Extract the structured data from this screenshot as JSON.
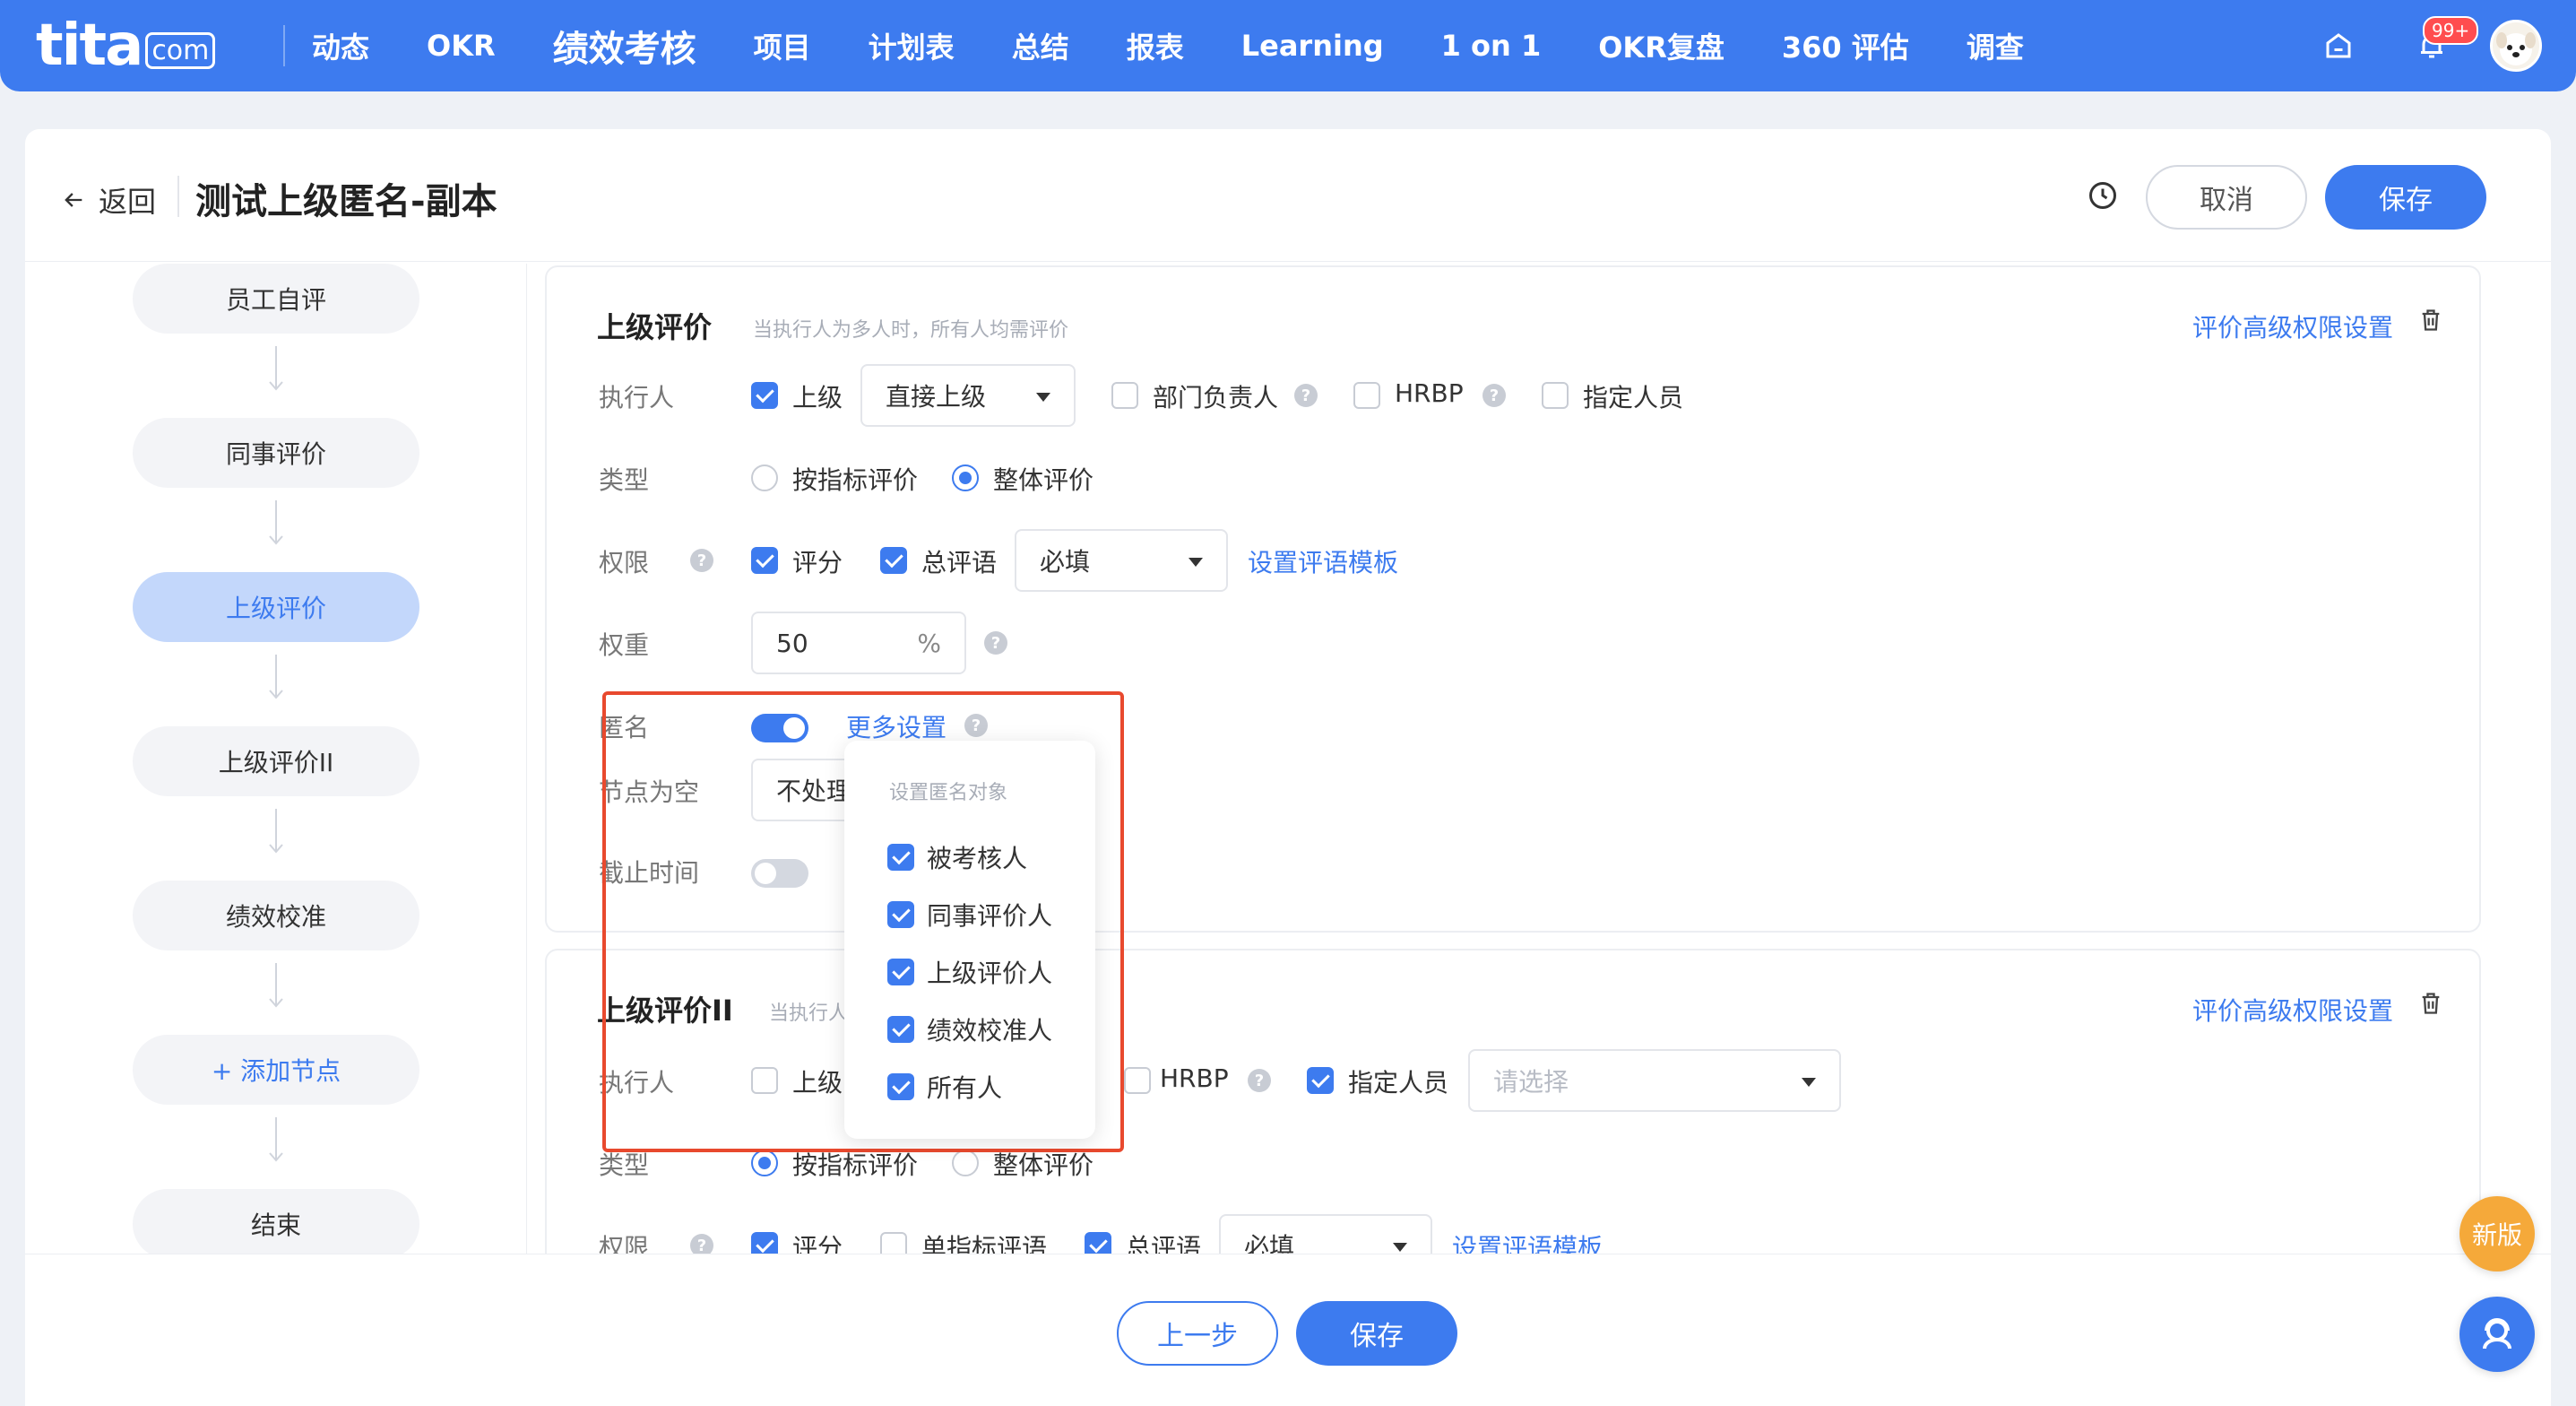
{
  "app": {
    "logo": "tita",
    "logo_suffix": "com",
    "notification_badge": "99+",
    "colors": {
      "primary": "#3d7bef",
      "highlight": "#e8492e",
      "new_badge": "#f5a93a"
    }
  },
  "nav": {
    "items": [
      "动态",
      "OKR",
      "绩效考核",
      "项目",
      "计划表",
      "总结",
      "报表",
      "Learning",
      "1 on 1",
      "OKR复盘",
      "360 评估",
      "调查"
    ],
    "active_index": 2
  },
  "header": {
    "back_label": "返回",
    "title": "测试上级匿名-副本",
    "cancel_label": "取消",
    "save_label": "保存"
  },
  "flow": {
    "nodes": [
      "员工自评",
      "同事评价",
      "上级评价",
      "上级评价II",
      "绩效校准",
      "+ 添加节点",
      "结束"
    ],
    "active_index": 2
  },
  "section1": {
    "title": "上级评价",
    "hint": "当执行人为多人时，所有人均需评价",
    "advanced_link": "评价高级权限设置",
    "executor_label": "执行人",
    "executor_superior": "上级",
    "executor_select": "直接上级",
    "dept_head": "部门负责人",
    "hrbp": "HRBP",
    "designated": "指定人员",
    "type_label": "类型",
    "type_by_indicator": "按指标评价",
    "type_overall": "整体评价",
    "perm_label": "权限",
    "perm_score": "评分",
    "perm_comment": "总评语",
    "perm_select": "必填",
    "comment_template_link": "设置评语模板",
    "weight_label": "权重",
    "weight_value": "50",
    "weight_unit": "%",
    "anon_label": "匿名",
    "more_settings": "更多设置",
    "empty_label": "节点为空",
    "empty_value": "不处理",
    "deadline_label": "截止时间"
  },
  "anon_popup": {
    "title": "设置匿名对象",
    "items": [
      "被考核人",
      "同事评价人",
      "上级评价人",
      "绩效校准人",
      "所有人"
    ]
  },
  "section2": {
    "title": "上级评价II",
    "hint": "当执行人为多人时，所有人均需评价",
    "advanced_link": "评价高级权限设置",
    "executor_label": "执行人",
    "executor_superior": "上级",
    "hrbp": "HRBP",
    "designated": "指定人员",
    "designated_placeholder": "请选择",
    "type_label": "类型",
    "type_by_indicator": "按指标评价",
    "type_overall": "整体评价",
    "perm_label": "权限",
    "perm_score": "评分",
    "perm_single_comment": "单指标评语",
    "perm_comment": "总评语",
    "perm_select": "必填",
    "comment_template_link": "设置评语模板"
  },
  "footer": {
    "prev_label": "上一步",
    "save_label": "保存",
    "new_badge": "新版"
  }
}
